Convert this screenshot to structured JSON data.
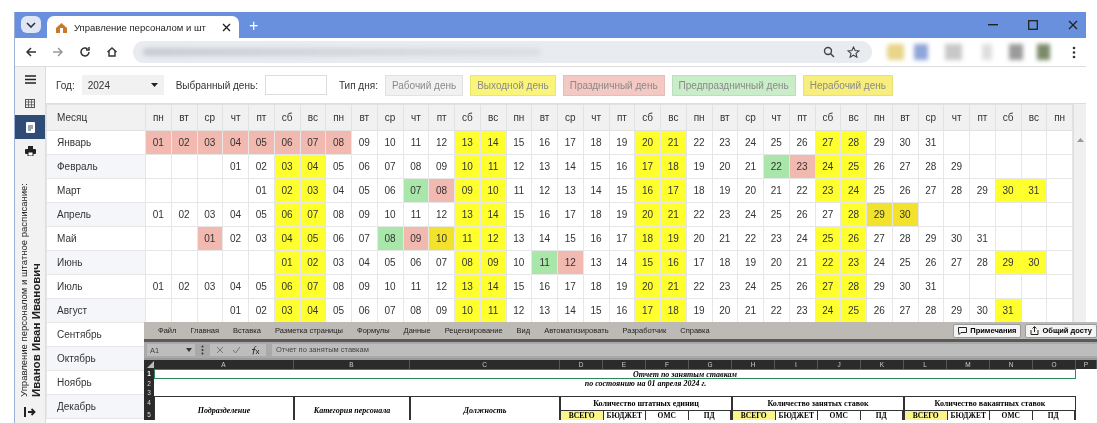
{
  "browser": {
    "tab_title": "Управление персоналом и шт",
    "new_tab": "+"
  },
  "sidebar": {
    "items": [
      {
        "kind": "menu",
        "selected": false
      },
      {
        "kind": "grid",
        "selected": false
      },
      {
        "kind": "document",
        "selected": true
      },
      {
        "kind": "print",
        "selected": false
      }
    ],
    "caption": "Управление персоналом и штатное расписание:",
    "user": "Иванов Иван Иванович"
  },
  "filters": {
    "year_label": "Год:",
    "year": "2024",
    "day_label": "Выбранный день:",
    "day_type_label": "Тип дня:",
    "legend": [
      {
        "label": "Рабочий день",
        "kind": "work"
      },
      {
        "label": "Выходной день",
        "kind": "off"
      },
      {
        "label": "Праздничный день",
        "kind": "holiday"
      },
      {
        "label": "Предпраздничный день",
        "kind": "preholiday"
      },
      {
        "label": "Нерабочий день",
        "kind": "nonwork"
      }
    ]
  },
  "calendar": {
    "month_header": "Месяц",
    "weekdays": [
      "пн",
      "вт",
      "ср",
      "чт",
      "пт",
      "сб",
      "вс",
      "пн",
      "вт",
      "ср",
      "чт",
      "пт",
      "сб",
      "вс",
      "пн",
      "вт",
      "ср",
      "чт",
      "пт",
      "сб",
      "вс",
      "пн",
      "вт",
      "ср",
      "чт",
      "пт",
      "сб",
      "вс",
      "пн",
      "вт",
      "ср",
      "чт",
      "пт",
      "сб",
      "вс",
      "пн"
    ],
    "months": [
      {
        "name": "Январь",
        "cells": [
          {
            "day": "01",
            "kind": "holiday"
          },
          {
            "day": "02",
            "kind": "holiday"
          },
          {
            "day": "03",
            "kind": "holiday"
          },
          {
            "day": "04",
            "kind": "holiday"
          },
          {
            "day": "05",
            "kind": "holiday"
          },
          {
            "day": "06",
            "kind": "holiday"
          },
          {
            "day": "07",
            "kind": "holiday"
          },
          {
            "day": "08",
            "kind": "holiday"
          },
          {
            "day": "09",
            "kind": "work"
          },
          {
            "day": "10",
            "kind": "work"
          },
          {
            "day": "11",
            "kind": "work"
          },
          {
            "day": "12",
            "kind": "work"
          },
          {
            "day": "13",
            "kind": "off"
          },
          {
            "day": "14",
            "kind": "off"
          },
          {
            "day": "15",
            "kind": "work"
          },
          {
            "day": "16",
            "kind": "work"
          },
          {
            "day": "17",
            "kind": "work"
          },
          {
            "day": "18",
            "kind": "work"
          },
          {
            "day": "19",
            "kind": "work"
          },
          {
            "day": "20",
            "kind": "off"
          },
          {
            "day": "21",
            "kind": "off"
          },
          {
            "day": "22",
            "kind": "work"
          },
          {
            "day": "23",
            "kind": "work"
          },
          {
            "day": "24",
            "kind": "work"
          },
          {
            "day": "25",
            "kind": "work"
          },
          {
            "day": "26",
            "kind": "work"
          },
          {
            "day": "27",
            "kind": "off"
          },
          {
            "day": "28",
            "kind": "off"
          },
          {
            "day": "29",
            "kind": "work"
          },
          {
            "day": "30",
            "kind": "work"
          },
          {
            "day": "31",
            "kind": "work"
          }
        ]
      },
      {
        "name": "Февраль",
        "cells": [
          null,
          null,
          null,
          {
            "day": "01",
            "kind": "work"
          },
          {
            "day": "02",
            "kind": "work"
          },
          {
            "day": "03",
            "kind": "off"
          },
          {
            "day": "04",
            "kind": "off"
          },
          {
            "day": "05",
            "kind": "work"
          },
          {
            "day": "06",
            "kind": "work"
          },
          {
            "day": "07",
            "kind": "work"
          },
          {
            "day": "08",
            "kind": "work"
          },
          {
            "day": "09",
            "kind": "work"
          },
          {
            "day": "10",
            "kind": "off"
          },
          {
            "day": "11",
            "kind": "off"
          },
          {
            "day": "12",
            "kind": "work"
          },
          {
            "day": "13",
            "kind": "work"
          },
          {
            "day": "14",
            "kind": "work"
          },
          {
            "day": "15",
            "kind": "work"
          },
          {
            "day": "16",
            "kind": "work"
          },
          {
            "day": "17",
            "kind": "off"
          },
          {
            "day": "18",
            "kind": "off"
          },
          {
            "day": "19",
            "kind": "work"
          },
          {
            "day": "20",
            "kind": "work"
          },
          {
            "day": "21",
            "kind": "work"
          },
          {
            "day": "22",
            "kind": "preholiday"
          },
          {
            "day": "23",
            "kind": "holiday"
          },
          {
            "day": "24",
            "kind": "off"
          },
          {
            "day": "25",
            "kind": "off"
          },
          {
            "day": "26",
            "kind": "work"
          },
          {
            "day": "27",
            "kind": "work"
          },
          {
            "day": "28",
            "kind": "work"
          },
          {
            "day": "29",
            "kind": "work"
          }
        ]
      },
      {
        "name": "Март",
        "cells": [
          null,
          null,
          null,
          null,
          {
            "day": "01",
            "kind": "work"
          },
          {
            "day": "02",
            "kind": "off"
          },
          {
            "day": "03",
            "kind": "off"
          },
          {
            "day": "04",
            "kind": "work"
          },
          {
            "day": "05",
            "kind": "work"
          },
          {
            "day": "06",
            "kind": "work"
          },
          {
            "day": "07",
            "kind": "preholiday"
          },
          {
            "day": "08",
            "kind": "holiday"
          },
          {
            "day": "09",
            "kind": "off"
          },
          {
            "day": "10",
            "kind": "off"
          },
          {
            "day": "11",
            "kind": "work"
          },
          {
            "day": "12",
            "kind": "work"
          },
          {
            "day": "13",
            "kind": "work"
          },
          {
            "day": "14",
            "kind": "work"
          },
          {
            "day": "15",
            "kind": "work"
          },
          {
            "day": "16",
            "kind": "off"
          },
          {
            "day": "17",
            "kind": "off"
          },
          {
            "day": "18",
            "kind": "work"
          },
          {
            "day": "19",
            "kind": "work"
          },
          {
            "day": "20",
            "kind": "work"
          },
          {
            "day": "21",
            "kind": "work"
          },
          {
            "day": "22",
            "kind": "work"
          },
          {
            "day": "23",
            "kind": "off"
          },
          {
            "day": "24",
            "kind": "off"
          },
          {
            "day": "25",
            "kind": "work"
          },
          {
            "day": "26",
            "kind": "work"
          },
          {
            "day": "27",
            "kind": "work"
          },
          {
            "day": "28",
            "kind": "work"
          },
          {
            "day": "29",
            "kind": "work"
          },
          {
            "day": "30",
            "kind": "off"
          },
          {
            "day": "31",
            "kind": "off"
          }
        ]
      },
      {
        "name": "Апрель",
        "cells": [
          {
            "day": "01",
            "kind": "work"
          },
          {
            "day": "02",
            "kind": "work"
          },
          {
            "day": "03",
            "kind": "work"
          },
          {
            "day": "04",
            "kind": "work"
          },
          {
            "day": "05",
            "kind": "work"
          },
          {
            "day": "06",
            "kind": "off"
          },
          {
            "day": "07",
            "kind": "off"
          },
          {
            "day": "08",
            "kind": "work"
          },
          {
            "day": "09",
            "kind": "work"
          },
          {
            "day": "10",
            "kind": "work"
          },
          {
            "day": "11",
            "kind": "work"
          },
          {
            "day": "12",
            "kind": "work"
          },
          {
            "day": "13",
            "kind": "off"
          },
          {
            "day": "14",
            "kind": "off"
          },
          {
            "day": "15",
            "kind": "work"
          },
          {
            "day": "16",
            "kind": "work"
          },
          {
            "day": "17",
            "kind": "work"
          },
          {
            "day": "18",
            "kind": "work"
          },
          {
            "day": "19",
            "kind": "work"
          },
          {
            "day": "20",
            "kind": "off"
          },
          {
            "day": "21",
            "kind": "off"
          },
          {
            "day": "22",
            "kind": "work"
          },
          {
            "day": "23",
            "kind": "work"
          },
          {
            "day": "24",
            "kind": "work"
          },
          {
            "day": "25",
            "kind": "work"
          },
          {
            "day": "26",
            "kind": "work"
          },
          {
            "day": "27",
            "kind": "work"
          },
          {
            "day": "28",
            "kind": "off"
          },
          {
            "day": "29",
            "kind": "nonwork"
          },
          {
            "day": "30",
            "kind": "nonwork"
          }
        ]
      },
      {
        "name": "Май",
        "cells": [
          null,
          null,
          {
            "day": "01",
            "kind": "holiday"
          },
          {
            "day": "02",
            "kind": "work"
          },
          {
            "day": "03",
            "kind": "work"
          },
          {
            "day": "04",
            "kind": "off"
          },
          {
            "day": "05",
            "kind": "off"
          },
          {
            "day": "06",
            "kind": "work"
          },
          {
            "day": "07",
            "kind": "work"
          },
          {
            "day": "08",
            "kind": "preholiday"
          },
          {
            "day": "09",
            "kind": "holiday"
          },
          {
            "day": "10",
            "kind": "nonwork"
          },
          {
            "day": "11",
            "kind": "off"
          },
          {
            "day": "12",
            "kind": "off"
          },
          {
            "day": "13",
            "kind": "work"
          },
          {
            "day": "14",
            "kind": "work"
          },
          {
            "day": "15",
            "kind": "work"
          },
          {
            "day": "16",
            "kind": "work"
          },
          {
            "day": "17",
            "kind": "work"
          },
          {
            "day": "18",
            "kind": "off"
          },
          {
            "day": "19",
            "kind": "off"
          },
          {
            "day": "20",
            "kind": "work"
          },
          {
            "day": "21",
            "kind": "work"
          },
          {
            "day": "22",
            "kind": "work"
          },
          {
            "day": "23",
            "kind": "work"
          },
          {
            "day": "24",
            "kind": "work"
          },
          {
            "day": "25",
            "kind": "off"
          },
          {
            "day": "26",
            "kind": "off"
          },
          {
            "day": "27",
            "kind": "work"
          },
          {
            "day": "28",
            "kind": "work"
          },
          {
            "day": "29",
            "kind": "work"
          },
          {
            "day": "30",
            "kind": "work"
          },
          {
            "day": "31",
            "kind": "work"
          }
        ]
      },
      {
        "name": "Июнь",
        "cells": [
          null,
          null,
          null,
          null,
          null,
          {
            "day": "01",
            "kind": "off"
          },
          {
            "day": "02",
            "kind": "off"
          },
          {
            "day": "03",
            "kind": "work"
          },
          {
            "day": "04",
            "kind": "work"
          },
          {
            "day": "05",
            "kind": "work"
          },
          {
            "day": "06",
            "kind": "work"
          },
          {
            "day": "07",
            "kind": "work"
          },
          {
            "day": "08",
            "kind": "off"
          },
          {
            "day": "09",
            "kind": "off"
          },
          {
            "day": "10",
            "kind": "work"
          },
          {
            "day": "11",
            "kind": "preholiday"
          },
          {
            "day": "12",
            "kind": "holiday"
          },
          {
            "day": "13",
            "kind": "work"
          },
          {
            "day": "14",
            "kind": "work"
          },
          {
            "day": "15",
            "kind": "off"
          },
          {
            "day": "16",
            "kind": "off"
          },
          {
            "day": "17",
            "kind": "work"
          },
          {
            "day": "18",
            "kind": "work"
          },
          {
            "day": "19",
            "kind": "work"
          },
          {
            "day": "20",
            "kind": "work"
          },
          {
            "day": "21",
            "kind": "work"
          },
          {
            "day": "22",
            "kind": "off"
          },
          {
            "day": "23",
            "kind": "off"
          },
          {
            "day": "24",
            "kind": "work"
          },
          {
            "day": "25",
            "kind": "work"
          },
          {
            "day": "26",
            "kind": "work"
          },
          {
            "day": "27",
            "kind": "work"
          },
          {
            "day": "28",
            "kind": "work"
          },
          {
            "day": "29",
            "kind": "off"
          },
          {
            "day": "30",
            "kind": "off"
          }
        ]
      },
      {
        "name": "Июль",
        "cells": [
          {
            "day": "01",
            "kind": "work"
          },
          {
            "day": "02",
            "kind": "work"
          },
          {
            "day": "03",
            "kind": "work"
          },
          {
            "day": "04",
            "kind": "work"
          },
          {
            "day": "05",
            "kind": "work"
          },
          {
            "day": "06",
            "kind": "off"
          },
          {
            "day": "07",
            "kind": "off"
          },
          {
            "day": "08",
            "kind": "work"
          },
          {
            "day": "09",
            "kind": "work"
          },
          {
            "day": "10",
            "kind": "work"
          },
          {
            "day": "11",
            "kind": "work"
          },
          {
            "day": "12",
            "kind": "work"
          },
          {
            "day": "13",
            "kind": "off"
          },
          {
            "day": "14",
            "kind": "off"
          },
          {
            "day": "15",
            "kind": "work"
          },
          {
            "day": "16",
            "kind": "work"
          },
          {
            "day": "17",
            "kind": "work"
          },
          {
            "day": "18",
            "kind": "work"
          },
          {
            "day": "19",
            "kind": "work"
          },
          {
            "day": "20",
            "kind": "off"
          },
          {
            "day": "21",
            "kind": "off"
          },
          {
            "day": "22",
            "kind": "work"
          },
          {
            "day": "23",
            "kind": "work"
          },
          {
            "day": "24",
            "kind": "work"
          },
          {
            "day": "25",
            "kind": "work"
          },
          {
            "day": "26",
            "kind": "work"
          },
          {
            "day": "27",
            "kind": "off"
          },
          {
            "day": "28",
            "kind": "off"
          },
          {
            "day": "29",
            "kind": "work"
          },
          {
            "day": "30",
            "kind": "work"
          },
          {
            "day": "31",
            "kind": "work"
          }
        ]
      },
      {
        "name": "Август",
        "cells": [
          null,
          null,
          null,
          {
            "day": "01",
            "kind": "work"
          },
          {
            "day": "02",
            "kind": "work"
          },
          {
            "day": "03",
            "kind": "off"
          },
          {
            "day": "04",
            "kind": "off"
          },
          {
            "day": "05",
            "kind": "work"
          },
          {
            "day": "06",
            "kind": "work"
          },
          {
            "day": "07",
            "kind": "work"
          },
          {
            "day": "08",
            "kind": "work"
          },
          {
            "day": "09",
            "kind": "work"
          },
          {
            "day": "10",
            "kind": "off"
          },
          {
            "day": "11",
            "kind": "off"
          },
          {
            "day": "12",
            "kind": "work"
          },
          {
            "day": "13",
            "kind": "work"
          },
          {
            "day": "14",
            "kind": "work"
          },
          {
            "day": "15",
            "kind": "work"
          },
          {
            "day": "16",
            "kind": "work"
          },
          {
            "day": "17",
            "kind": "off"
          },
          {
            "day": "18",
            "kind": "off"
          },
          {
            "day": "19",
            "kind": "work"
          },
          {
            "day": "20",
            "kind": "work"
          },
          {
            "day": "21",
            "kind": "work"
          },
          {
            "day": "22",
            "kind": "work"
          },
          {
            "day": "23",
            "kind": "work"
          },
          {
            "day": "24",
            "kind": "off"
          },
          {
            "day": "25",
            "kind": "off"
          },
          {
            "day": "26",
            "kind": "work"
          },
          {
            "day": "27",
            "kind": "work"
          },
          {
            "day": "28",
            "kind": "work"
          },
          {
            "day": "29",
            "kind": "work"
          },
          {
            "day": "30",
            "kind": "work"
          },
          {
            "day": "31",
            "kind": "off"
          }
        ]
      },
      {
        "name": "Сентябрь"
      },
      {
        "name": "Октябрь"
      },
      {
        "name": "Ноябрь"
      },
      {
        "name": "Декабрь"
      }
    ]
  },
  "spreadsheet": {
    "ribbon_tabs": [
      "Файл",
      "Главная",
      "Вставка",
      "Разметка страницы",
      "Формулы",
      "Данные",
      "Рецензирование",
      "Вид",
      "Автоматизировать",
      "Разработчик",
      "Справка"
    ],
    "comments_button": "Примечания",
    "share_button": "Общий досту",
    "name_box": "A1",
    "formula": "Отчет по занятым ставкам",
    "columns": [
      "A",
      "B",
      "C",
      "D",
      "E",
      "F",
      "G",
      "H",
      "I",
      "J",
      "K",
      "L",
      "M",
      "N",
      "O",
      "P"
    ],
    "row_numbers": [
      "1",
      "2",
      "3",
      "4",
      "5"
    ],
    "title": "Отчет по занятым ставкам",
    "subtitle": "по состоянию на 01 апреля 2024 г.",
    "headers": [
      "Подразделение",
      "Категория персонала",
      "Должность"
    ],
    "groups": [
      {
        "label": "Количество штатных единиц",
        "subcolumns": [
          "ВСЕГО",
          "БЮДЖЕТ",
          "ОМС",
          "ПД"
        ]
      },
      {
        "label": "Количество занятых ставок",
        "subcolumns": [
          "ВСЕГО",
          "БЮДЖЕТ",
          "ОМС",
          "ПД"
        ]
      },
      {
        "label": "Количество вакантных ставок",
        "subcolumns": [
          "ВСЕГО",
          "БЮДЖЕТ",
          "ОМС",
          "ПД"
        ]
      }
    ]
  }
}
